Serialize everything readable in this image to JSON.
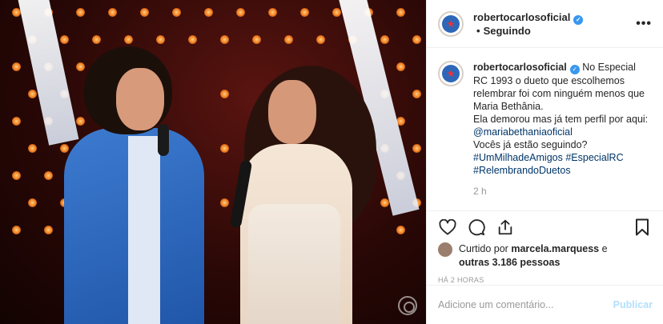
{
  "post": {
    "username": "robertocarlosoficial",
    "separator": "•",
    "follow_status": "Seguindo",
    "more_icon": "more-dots-icon",
    "caption": {
      "body_line1": "No Especial RC 1993 o dueto que escolhemos relembrar foi com ninguém menos que Maria Bethânia.",
      "body_line2": "Ela demorou mas já tem perfil por aqui: ",
      "mention": "@mariabethaniaoficial",
      "body_line3": "Vocês já estão seguindo?",
      "tag1": "#UmMilhadeAmigos",
      "tag2": "#EspecialRC",
      "tag3": "#RelembrandoDuetos",
      "time_ago": "2 h"
    },
    "actions": {
      "like_icon": "heart-icon",
      "comment_icon": "comment-icon",
      "share_icon": "share-icon",
      "save_icon": "bookmark-icon"
    },
    "likes": {
      "prefix": "Curtido por",
      "user": "marcela.marquess",
      "joiner": "e",
      "others": "outras 3.186 pessoas"
    },
    "timestamp": "HÁ 2 HORAS",
    "comment": {
      "placeholder": "Adicione um comentário...",
      "publish_label": "Publicar"
    }
  },
  "colors": {
    "verified": "#3897f0",
    "link": "#003569",
    "publish_disabled": "#b2dffc",
    "muted": "#999999"
  }
}
